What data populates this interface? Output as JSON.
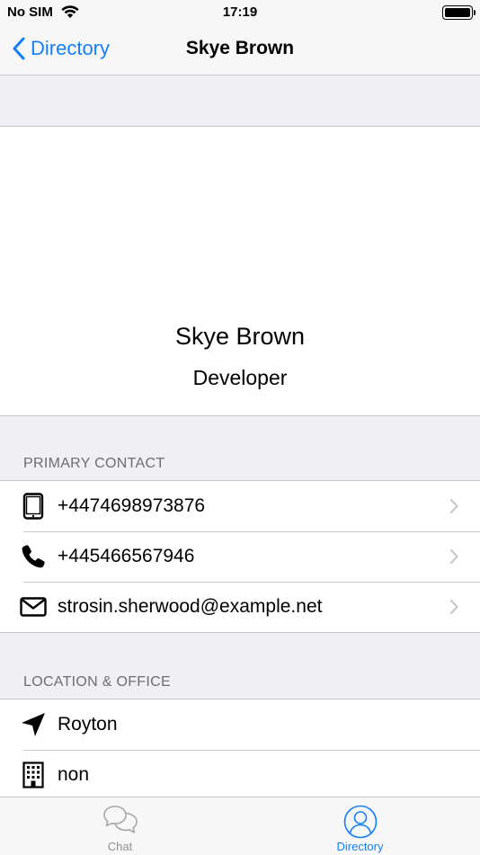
{
  "status": {
    "carrier": "No SIM",
    "time": "17:19"
  },
  "nav": {
    "back_label": "Directory",
    "title": "Skye Brown"
  },
  "profile": {
    "name": "Skye Brown",
    "role": "Developer"
  },
  "primary_contact": {
    "header": "PRIMARY CONTACT",
    "items": [
      {
        "icon": "tablet-icon",
        "value": "+4474698973876"
      },
      {
        "icon": "phone-icon",
        "value": "+445466567946"
      },
      {
        "icon": "email-icon",
        "value": "strosin.sherwood@example.net"
      }
    ]
  },
  "location_office": {
    "header": "LOCATION & OFFICE",
    "items": [
      {
        "icon": "location-arrow-icon",
        "value": "Royton"
      },
      {
        "icon": "building-icon",
        "value": "non"
      }
    ]
  },
  "tabs": [
    {
      "label": "Chat",
      "icon": "chat-bubbles-icon",
      "active": false
    },
    {
      "label": "Directory",
      "icon": "person-icon",
      "active": true
    }
  ],
  "colors": {
    "accent": "#147efb",
    "background": "#efeff4",
    "separator": "#c8c7cc",
    "inactive": "#929292"
  }
}
